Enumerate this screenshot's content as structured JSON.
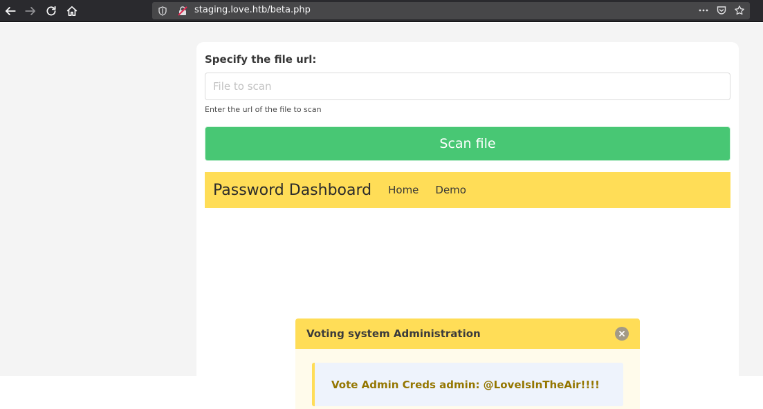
{
  "browser": {
    "url": "staging.love.htb/beta.php",
    "icons": [
      "back-icon",
      "forward-icon",
      "reload-icon",
      "home-icon",
      "shield-icon",
      "insecure-lock-icon",
      "more-icon",
      "pocket-icon",
      "bookmark-star-icon"
    ]
  },
  "form": {
    "label": "Specify the file url:",
    "input_placeholder": "File to scan",
    "input_value": "",
    "help": "Enter the url of the file to scan",
    "button_label": "Scan file"
  },
  "navbar": {
    "brand": "Password Dashboard",
    "links": [
      "Home",
      "Demo"
    ]
  },
  "modal": {
    "title": "Voting system Administration",
    "message": "Vote Admin Creds admin: @LoveIsInTheAir!!!!"
  },
  "colors": {
    "success": "#48c774",
    "warning": "#ffdd57",
    "message_text": "#947600",
    "toolbar": "#2a2a2e"
  }
}
